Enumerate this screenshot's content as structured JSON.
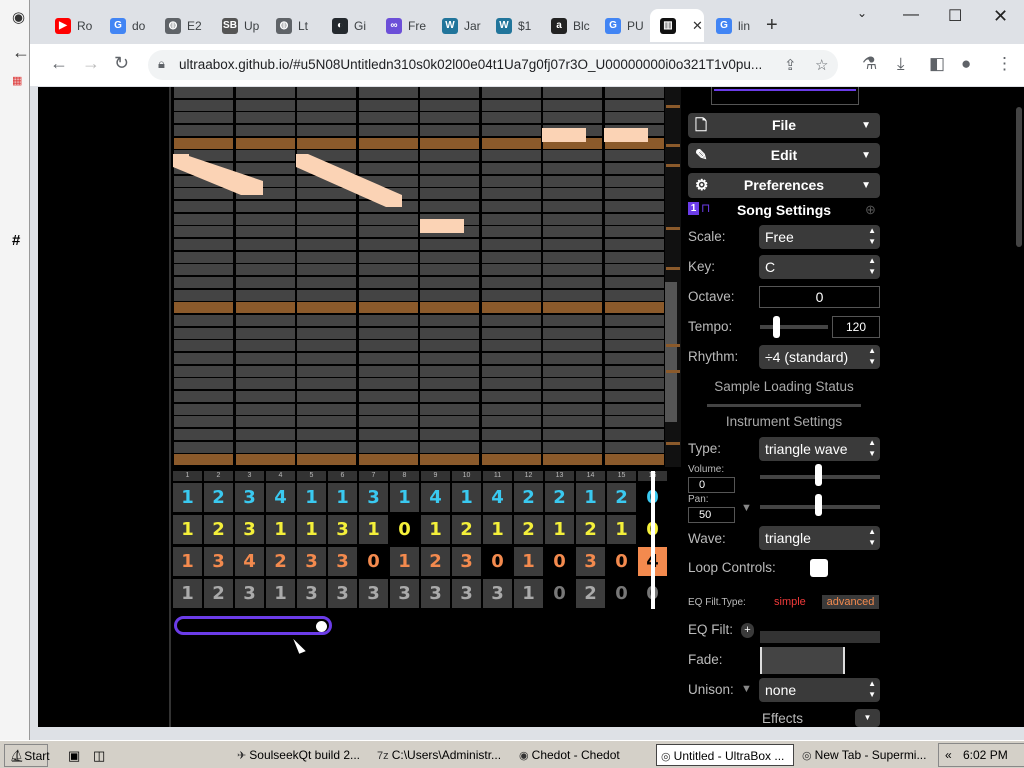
{
  "background_window": {
    "hash_char": "#"
  },
  "browser": {
    "tabs": [
      {
        "label": "Ro",
        "icon": "youtube-icon",
        "color": "#ff0000"
      },
      {
        "label": "do",
        "icon": "google-icon",
        "color": "#4285f4"
      },
      {
        "label": "E2",
        "icon": "globe-icon",
        "color": "#5f6368"
      },
      {
        "label": "Up",
        "icon": "sb-icon",
        "color": "#555555"
      },
      {
        "label": "Lt",
        "icon": "globe-icon",
        "color": "#5f6368"
      },
      {
        "label": "Gi",
        "icon": "github-icon",
        "color": "#24292e"
      },
      {
        "label": "Fre",
        "icon": "infinity-icon",
        "color": "#6c4fd8"
      },
      {
        "label": "Jar",
        "icon": "wordpress-icon",
        "color": "#21759b"
      },
      {
        "label": "$1",
        "icon": "wordpress-icon",
        "color": "#21759b"
      },
      {
        "label": "Blc",
        "icon": "amazon-icon",
        "color": "#222222"
      },
      {
        "label": "PU",
        "icon": "google-icon",
        "color": "#4285f4"
      },
      {
        "label": "",
        "icon": "ultrabox-icon",
        "color": "#111111",
        "active": true
      },
      {
        "label": "lin",
        "icon": "google-icon",
        "color": "#4285f4"
      }
    ],
    "new_tab": "+",
    "url": "ultraabox.github.io/#u5N08Untitledn310s0k02l00e04t1Ua7g0fj07r3O_U00000000i0o321T1v0pu..."
  },
  "menus": {
    "file": "File",
    "edit": "Edit",
    "preferences": "Preferences"
  },
  "song_settings": {
    "title": "Song Settings",
    "scale_label": "Scale:",
    "scale_value": "Free",
    "key_label": "Key:",
    "key_value": "C",
    "octave_label": "Octave:",
    "octave_value": "0",
    "tempo_label": "Tempo:",
    "tempo_value": "120",
    "rhythm_label": "Rhythm:",
    "rhythm_value": "÷4 (standard)",
    "sample_status": "Sample Loading Status"
  },
  "instrument_settings": {
    "title": "Instrument Settings",
    "type_label": "Type:",
    "type_value": "triangle wave",
    "volume_label": "Volume:",
    "volume_value": "0",
    "pan_label": "Pan:",
    "pan_value": "50",
    "wave_label": "Wave:",
    "wave_value": "triangle",
    "loop_label": "Loop Controls:",
    "eq_type_label": "EQ Filt.Type:",
    "eq_simple": "simple",
    "eq_advanced": "advanced",
    "eq_filt_label": "EQ Filt:",
    "eq_add": "+",
    "fade_label": "Fade:",
    "unison_label": "Unison:",
    "unison_value": "none",
    "effects_label": "Effects"
  },
  "pattern": {
    "bar_numbers": [
      "1",
      "2",
      "3",
      "4",
      "5",
      "6",
      "7",
      "8",
      "9",
      "10",
      "11",
      "12",
      "13",
      "14",
      "15",
      "16"
    ],
    "channel_colors": [
      "#3ac9f0",
      "#f4f03a",
      "#f38a4e",
      "#aaaaaa"
    ],
    "rows": [
      [
        "1",
        "2",
        "3",
        "4",
        "1",
        "1",
        "3",
        "1",
        "4",
        "1",
        "4",
        "2",
        "2",
        "1",
        "2",
        "0"
      ],
      [
        "1",
        "2",
        "3",
        "1",
        "1",
        "3",
        "1",
        "0",
        "1",
        "2",
        "1",
        "2",
        "1",
        "2",
        "1",
        "0"
      ],
      [
        "1",
        "3",
        "4",
        "2",
        "3",
        "3",
        "0",
        "1",
        "2",
        "3",
        "0",
        "1",
        "0",
        "3",
        "0",
        "4"
      ],
      [
        "1",
        "2",
        "3",
        "1",
        "3",
        "3",
        "3",
        "3",
        "3",
        "3",
        "3",
        "1",
        "0",
        "2",
        "0",
        "0"
      ]
    ]
  },
  "taskbar": {
    "start": "Start",
    "items": [
      {
        "label": "SoulseekQt build 2...",
        "icon": "bird-icon"
      },
      {
        "label": "C:\\Users\\Administr...",
        "icon": "7zip-icon"
      },
      {
        "label": "Chedot - Chedot",
        "icon": "chedot-icon"
      },
      {
        "label": "Untitled - UltraBox ...",
        "icon": "chrome-icon",
        "active": true
      },
      {
        "label": "New Tab - Supermi...",
        "icon": "chrome-icon"
      }
    ],
    "tray_arrow": "«",
    "clock": "6:02 PM"
  }
}
